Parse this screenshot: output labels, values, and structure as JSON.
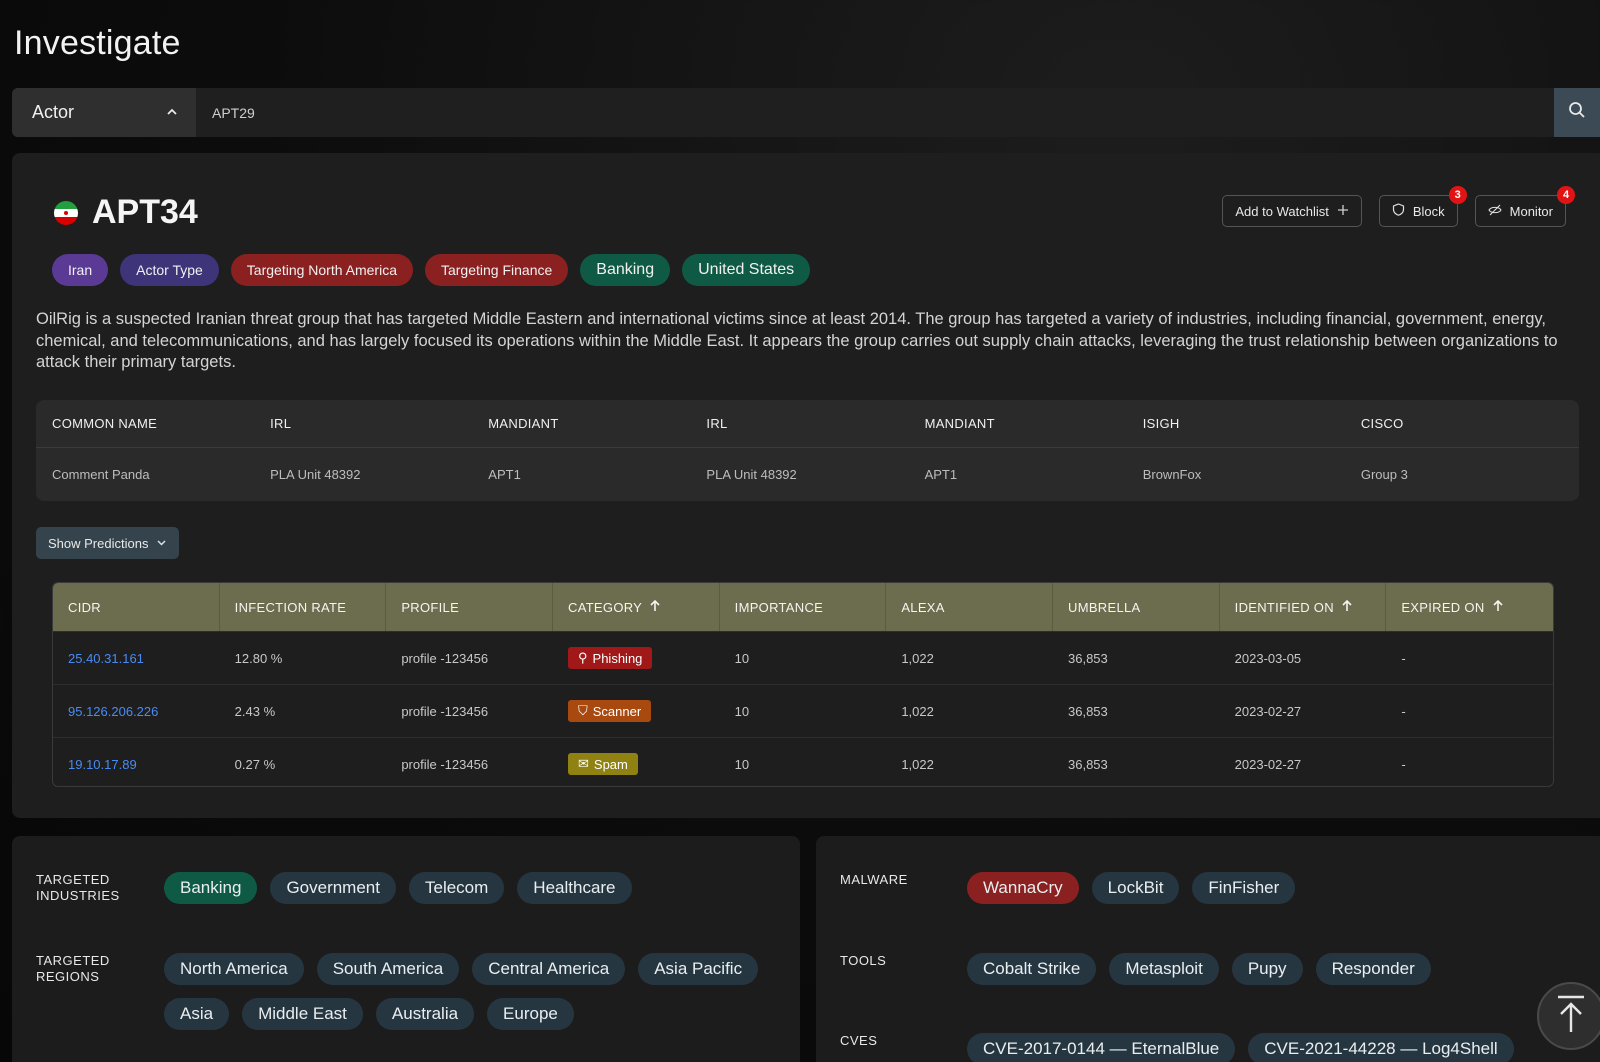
{
  "page": {
    "title": "Investigate"
  },
  "search": {
    "type_label": "Actor",
    "value": "APT29"
  },
  "actor": {
    "name": "APT34",
    "actions": {
      "watchlist": "Add to Watchlist",
      "block": "Block",
      "block_count": "3",
      "monitor": "Monitor",
      "monitor_count": "4"
    },
    "tags": [
      "Iran",
      "Actor Type",
      "Targeting North America",
      "Targeting Finance",
      "Banking",
      "United States"
    ],
    "description": "OilRig is a suspected Iranian threat group that has targeted Middle Eastern and international victims since at least 2014. The group has targeted a variety of industries, including financial, government, energy, chemical, and telecommunications, and has largely focused its operations within the Middle East. It appears the group carries out supply chain attacks, leveraging the trust relationship between organizations to attack their primary targets."
  },
  "names_table": {
    "headers": [
      "COMMON NAME",
      "IRL",
      "MANDIANT",
      "IRL",
      "MANDIANT",
      "ISIGH",
      "CISCO"
    ],
    "values": [
      "Comment Panda",
      "PLA Unit 48392",
      "APT1",
      "PLA Unit 48392",
      "APT1",
      "BrownFox",
      "Group 3"
    ]
  },
  "show_predictions": "Show Predictions",
  "data_table": {
    "headers": [
      "CIDR",
      "INFECTION RATE",
      "PROFILE",
      "CATEGORY",
      "IMPORTANCE",
      "ALEXA",
      "UMBRELLA",
      "IDENTIFIED ON",
      "EXPIRED ON"
    ],
    "rows": [
      {
        "cidr": "25.40.31.161",
        "rate": "12.80 %",
        "profile": "profile -123456",
        "category": "Phishing",
        "importance": "10",
        "alexa": "1,022",
        "umbrella": "36,853",
        "identified": "2023-03-05",
        "expired": "-"
      },
      {
        "cidr": "95.126.206.226",
        "rate": "2.43 %",
        "profile": "profile -123456",
        "category": "Scanner",
        "importance": "10",
        "alexa": "1,022",
        "umbrella": "36,853",
        "identified": "2023-02-27",
        "expired": "-"
      },
      {
        "cidr": "19.10.17.89",
        "rate": "0.27 %",
        "profile": "profile -123456",
        "category": "Spam",
        "importance": "10",
        "alexa": "1,022",
        "umbrella": "36,853",
        "identified": "2023-02-27",
        "expired": "-"
      }
    ]
  },
  "targets": {
    "industries_label": "TARGETED INDUSTRIES",
    "industries": [
      "Banking",
      "Government",
      "Telecom",
      "Healthcare"
    ],
    "regions_label": "TARGETED REGIONS",
    "regions": [
      "North America",
      "South America",
      "Central America",
      "Asia Pacific",
      "Asia",
      "Middle East",
      "Australia",
      "Europe"
    ]
  },
  "threats": {
    "malware_label": "MALWARE",
    "malware": [
      "WannaCry",
      "LockBit",
      "FinFisher"
    ],
    "tools_label": "TOOLS",
    "tools": [
      "Cobalt Strike",
      "Metasploit",
      "Pupy",
      "Responder"
    ],
    "cves_label": "CVES",
    "cves": [
      "CVE-2017-0144 — EternalBlue",
      "CVE-2021-44228 — Log4Shell"
    ]
  },
  "colors": {
    "accent_blue": "#4a8bf2",
    "alert_red": "#e11414",
    "table_header": "#6b6d4e"
  }
}
